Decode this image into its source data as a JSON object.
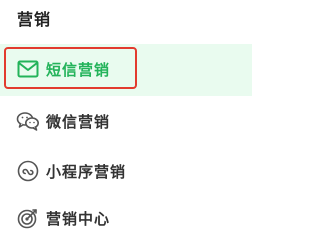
{
  "section": {
    "title": "营销"
  },
  "menu": {
    "items": [
      {
        "label": "短信营销",
        "icon": "envelope-icon",
        "active": true
      },
      {
        "label": "微信营销",
        "icon": "wechat-icon",
        "active": false
      },
      {
        "label": "小程序营销",
        "icon": "mini-program-icon",
        "active": false
      },
      {
        "label": "营销中心",
        "icon": "target-icon",
        "active": false
      }
    ]
  },
  "colors": {
    "active_text": "#23b35a",
    "active_background": "#e9fbef",
    "highlight_border": "#e23b2e",
    "text": "#333333",
    "icon": "#555555"
  }
}
